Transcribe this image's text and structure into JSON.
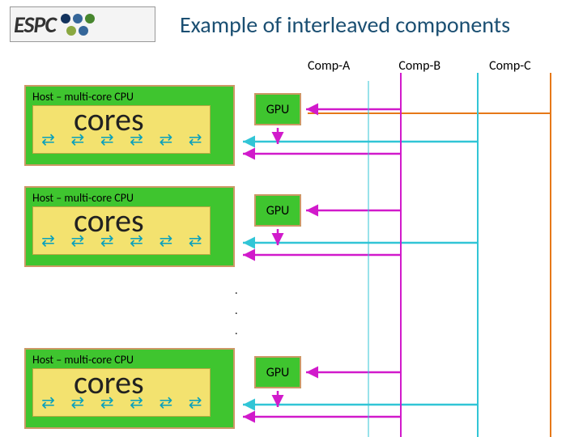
{
  "logo": {
    "text": "ESPC"
  },
  "title": "Example of interleaved components",
  "legend": {
    "a": "Comp-A",
    "b": "Comp-B",
    "c": "Comp-C"
  },
  "blocks": {
    "host_label": "Host – multi-core CPU",
    "cores_label": "cores",
    "gpu_label": "GPU"
  },
  "colors": {
    "comp_a": "#d11acb",
    "comp_b": "#31c5d6",
    "comp_c": "#e67818",
    "host_fill": "#3fc52f",
    "cores_fill": "#f3e26f"
  },
  "ellipsis": "."
}
